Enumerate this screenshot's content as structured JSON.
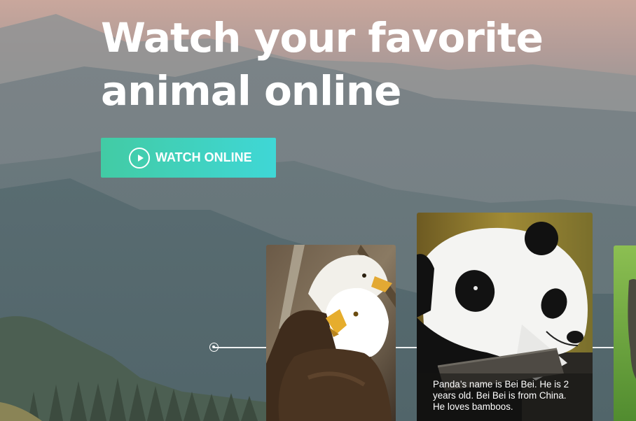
{
  "hero": {
    "title_line1": "Watch your favorite",
    "title_line2": "animal online"
  },
  "cta": {
    "label": "WATCH ONLINE",
    "icon": "play-icon"
  },
  "cards": [
    {
      "animal": "eagle"
    },
    {
      "animal": "panda",
      "caption": "Panda’s name is Bei Bei. He is 2 years old. Bei Bei is from China. He loves bamboos."
    },
    {
      "animal": "partially visible animal"
    }
  ],
  "colors": {
    "button_gradient_start": "#42cba4",
    "button_gradient_end": "#3fd7d6",
    "text": "#ffffff"
  }
}
